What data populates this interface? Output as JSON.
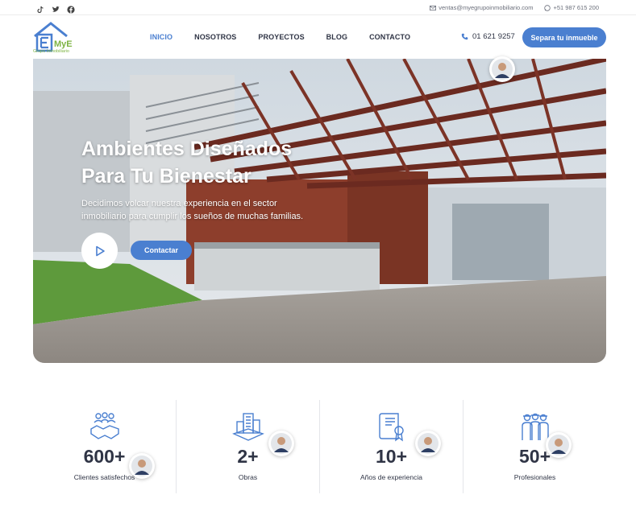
{
  "topbar": {
    "social": [
      "tiktok-icon",
      "twitter-icon",
      "facebook-icon"
    ],
    "email": "ventas@myegrupoinmobiliario.com",
    "whatsapp": "+51 987 615 200"
  },
  "header": {
    "logo_text": "MyE",
    "logo_subtitle": "Grupo Inmobiliario",
    "nav": [
      {
        "label": "INICIO",
        "active": true
      },
      {
        "label": "NOSOTROS",
        "active": false
      },
      {
        "label": "PROYECTOS",
        "active": false
      },
      {
        "label": "BLOG",
        "active": false
      },
      {
        "label": "CONTACTO",
        "active": false
      }
    ],
    "phone": "01 621 9257",
    "cta_label": "Separa tu inmueble"
  },
  "hero": {
    "title": "Ambientes Diseñados Para Tu Bienestar",
    "subtitle": "Decidimos volcar nuestra experiencia en el sector inmobiliario para cumplir los sueños de muchas familias.",
    "contact_label": "Contactar"
  },
  "stats": [
    {
      "icon": "handshake-icon",
      "value": "600+",
      "label": "Clientes satisfechos"
    },
    {
      "icon": "buildings-icon",
      "value": "2+",
      "label": "Obras"
    },
    {
      "icon": "certificate-icon",
      "value": "10+",
      "label": "Años de experiencia"
    },
    {
      "icon": "team-icon",
      "value": "50+",
      "label": "Profesionales"
    }
  ],
  "colors": {
    "accent": "#4a7fd0",
    "text": "#2f3445",
    "logo_green": "#7cb342"
  }
}
